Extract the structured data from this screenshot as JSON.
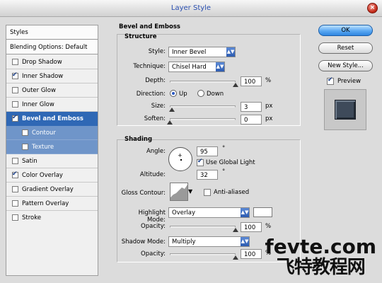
{
  "window": {
    "title": "Layer Style",
    "close_icon": "close-icon"
  },
  "left_panel": {
    "styles_header": "Styles",
    "blending_header": "Blending Options: Default",
    "items": [
      {
        "label": "Drop Shadow",
        "checked": false
      },
      {
        "label": "Inner Shadow",
        "checked": true
      },
      {
        "label": "Outer Glow",
        "checked": false
      },
      {
        "label": "Inner Glow",
        "checked": false
      },
      {
        "label": "Bevel and Emboss",
        "checked": true
      },
      {
        "label": "Contour",
        "checked": false
      },
      {
        "label": "Texture",
        "checked": false
      },
      {
        "label": "Satin",
        "checked": false
      },
      {
        "label": "Color Overlay",
        "checked": true
      },
      {
        "label": "Gradient Overlay",
        "checked": false
      },
      {
        "label": "Pattern Overlay",
        "checked": false
      },
      {
        "label": "Stroke",
        "checked": false
      }
    ]
  },
  "main": {
    "title": "Bevel and Emboss",
    "structure": {
      "title": "Structure",
      "style_label": "Style:",
      "style_value": "Inner Bevel",
      "technique_label": "Technique:",
      "technique_value": "Chisel Hard",
      "depth_label": "Depth:",
      "depth_value": "100",
      "depth_unit": "%",
      "direction_label": "Direction:",
      "direction_up": "Up",
      "direction_down": "Down",
      "size_label": "Size:",
      "size_value": "3",
      "size_unit": "px",
      "soften_label": "Soften:",
      "soften_value": "0",
      "soften_unit": "px"
    },
    "shading": {
      "title": "Shading",
      "angle_label": "Angle:",
      "angle_value": "95",
      "angle_unit": "°",
      "global_light_label": "Use Global Light",
      "altitude_label": "Altitude:",
      "altitude_value": "32",
      "altitude_unit": "°",
      "gloss_contour_label": "Gloss Contour:",
      "anti_aliased_label": "Anti-aliased",
      "highlight_mode_label": "Highlight Mode:",
      "highlight_mode_value": "Overlay",
      "highlight_color": "#ffffff",
      "highlight_opacity_label": "Opacity:",
      "highlight_opacity_value": "100",
      "highlight_opacity_unit": "%",
      "shadow_mode_label": "Shadow Mode:",
      "shadow_mode_value": "Multiply",
      "shadow_color": "#000000",
      "shadow_opacity_label": "Opacity:",
      "shadow_opacity_value": "100",
      "shadow_opacity_unit": "%"
    }
  },
  "right": {
    "ok_label": "OK",
    "reset_label": "Reset",
    "new_style_label": "New Style...",
    "preview_label": "Preview",
    "preview_checked": true,
    "preview_color": "#3e4a5a"
  },
  "watermark": {
    "line1": "fevte.com",
    "line2": "飞特教程网"
  }
}
